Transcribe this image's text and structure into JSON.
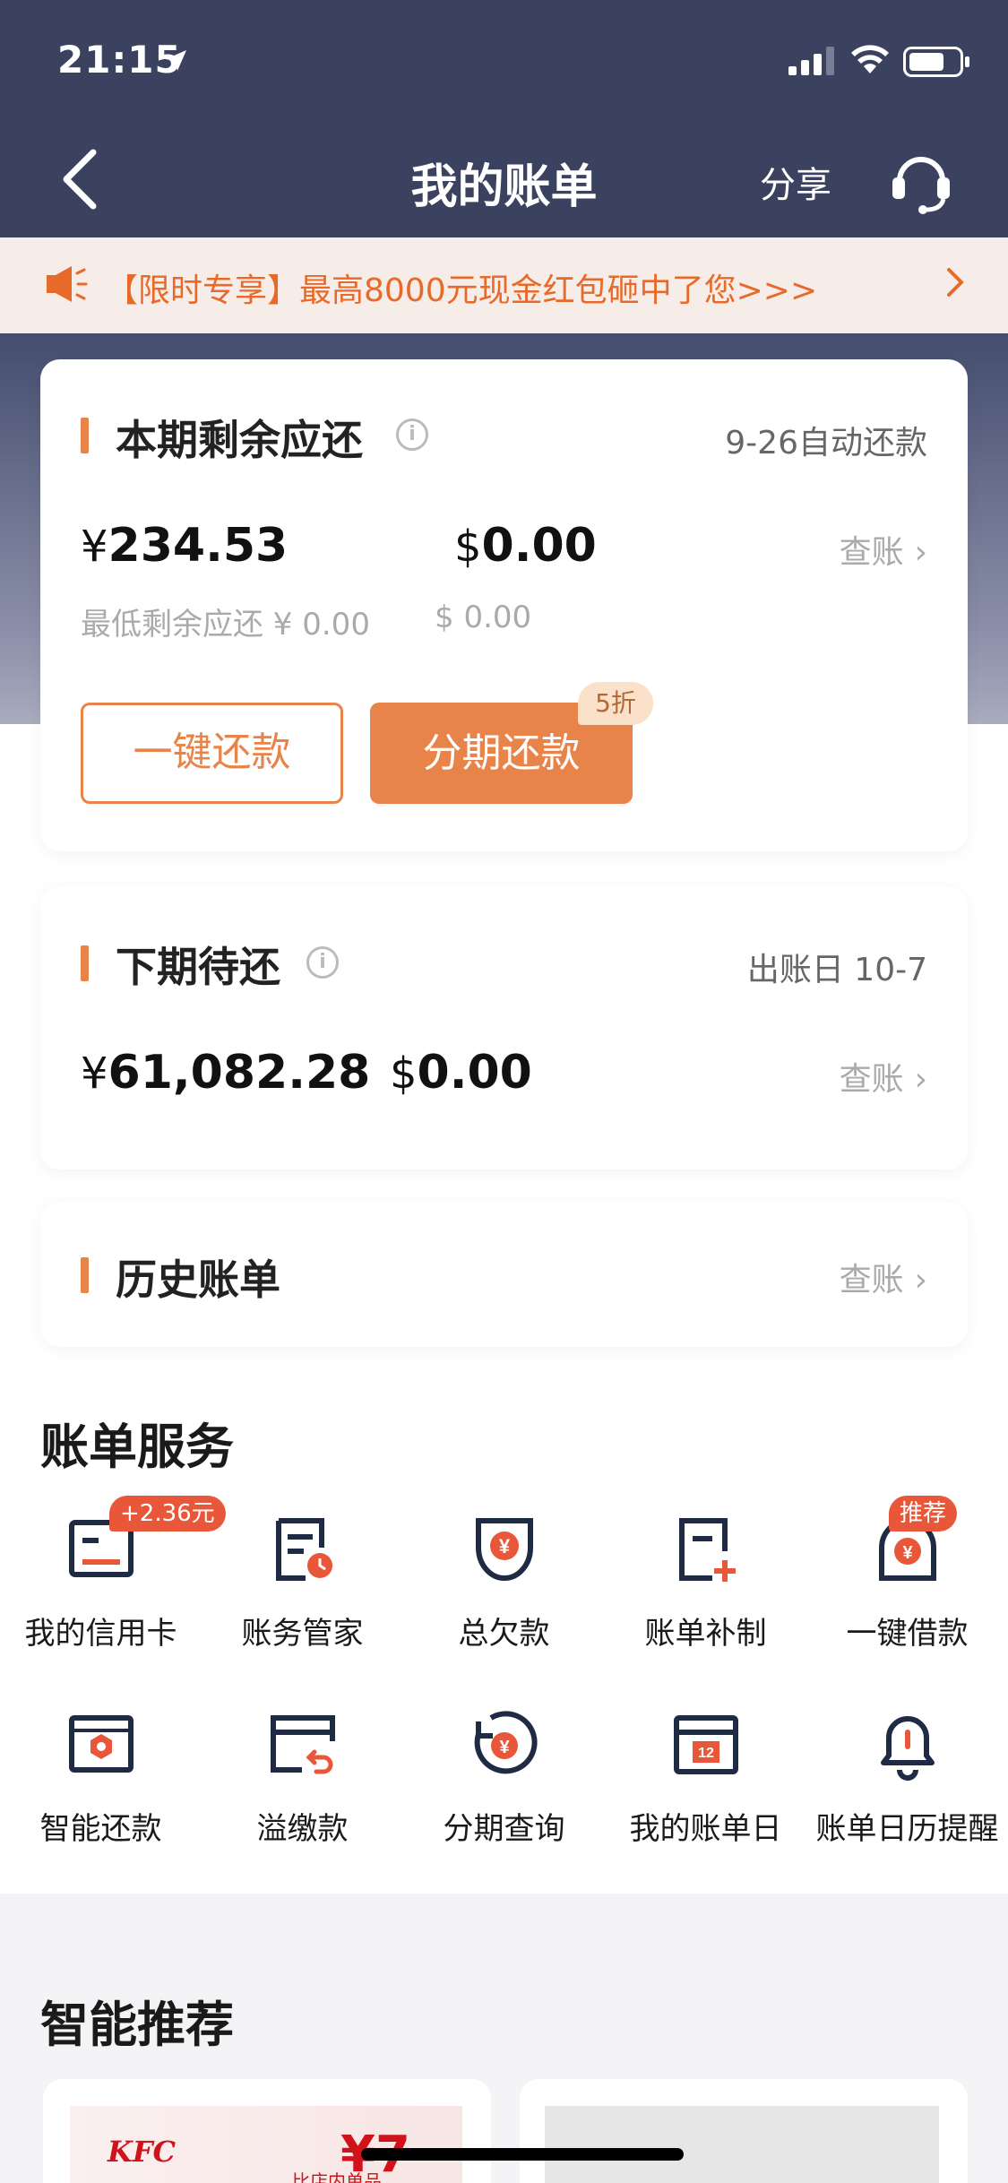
{
  "status_bar": {
    "time": "21:15"
  },
  "nav": {
    "title": "我的账单",
    "share": "分享"
  },
  "promo": {
    "text": "【限时专享】最高8000元现金红包砸中了您>>>"
  },
  "current_bill": {
    "title": "本期剩余应还",
    "auto_pay": "9-26自动还款",
    "cny_symbol": "¥",
    "cny_amount": "234.53",
    "usd_symbol": "$",
    "usd_amount": "0.00",
    "check": "查账",
    "min_label": "最低剩余应还 ¥ 0.00",
    "min_usd": "$ 0.00",
    "btn_repay": "一键还款",
    "btn_installment": "分期还款",
    "discount": "5折"
  },
  "next_bill": {
    "title": "下期待还",
    "statement_date": "出账日 10-7",
    "cny_symbol": "¥",
    "cny_amount": "61,082.28",
    "usd_symbol": "$",
    "usd_amount": "0.00",
    "check": "查账"
  },
  "history": {
    "title": "历史账单",
    "check": "查账"
  },
  "services": {
    "title": "账单服务",
    "items": [
      {
        "label": "我的信用卡",
        "icon": "credit-card-icon",
        "badge": "+2.36元"
      },
      {
        "label": "账务管家",
        "icon": "account-manager-icon"
      },
      {
        "label": "总欠款",
        "icon": "total-debt-icon"
      },
      {
        "label": "账单补制",
        "icon": "bill-reissue-icon"
      },
      {
        "label": "一键借款",
        "icon": "quick-loan-icon",
        "badge": "推荐"
      },
      {
        "label": "智能还款",
        "icon": "smart-repay-icon"
      },
      {
        "label": "溢缴款",
        "icon": "overpayment-icon"
      },
      {
        "label": "分期查询",
        "icon": "installment-query-icon"
      },
      {
        "label": "我的账单日",
        "icon": "bill-date-icon"
      },
      {
        "label": "账单日历提醒",
        "icon": "bell-icon"
      }
    ]
  },
  "recommend": {
    "title": "智能推荐",
    "kfc_logo": "KFC",
    "kfc_small": "比店内单品",
    "kfc_price": "¥7"
  },
  "colors": {
    "nav_bg": "#3a4260",
    "accent": "#e8844a",
    "promo_text": "#e86a2a",
    "badge": "#e8573a",
    "icon_dark": "#1f2a44"
  }
}
